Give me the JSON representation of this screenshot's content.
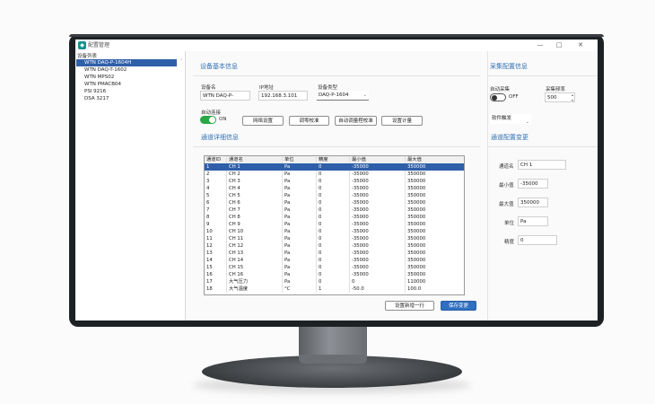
{
  "window": {
    "title": "配置管理",
    "icon": "app-icon",
    "min": "—",
    "max": "□",
    "close": "✕"
  },
  "device_list": {
    "header": "设备列表",
    "items": [
      {
        "label": "WTN DAQ-P-1604H",
        "selected": true
      },
      {
        "label": "WTN DAQ-T-1602",
        "selected": false
      },
      {
        "label": "WTN MPS02",
        "selected": false
      },
      {
        "label": "WTN PMACB04",
        "selected": false
      },
      {
        "label": "PSI 9216",
        "selected": false
      },
      {
        "label": "DSA 3217",
        "selected": false
      }
    ]
  },
  "basic": {
    "title": "设备基本信息",
    "name_label": "设备名",
    "name_value": "WTN DAQ-P-",
    "ip_label": "IP地址",
    "ip_value": "192.168.3.101",
    "type_label": "设备类型",
    "type_value": "DAQ-P-1604",
    "auto_label": "自动连接",
    "auto_state": "ON",
    "buttons": [
      "网络设置",
      "调零校准",
      "自动调量程校准",
      "设置计量"
    ]
  },
  "channels": {
    "title": "通道详细信息",
    "columns": [
      "通道ID",
      "通道名",
      "单位",
      "精度",
      "最小值",
      "最大值"
    ],
    "rows": [
      [
        "1",
        "CH 1",
        "Pa",
        "0",
        "-35000",
        "350000"
      ],
      [
        "2",
        "CH 2",
        "Pa",
        "0",
        "-35000",
        "350000"
      ],
      [
        "3",
        "CH 3",
        "Pa",
        "0",
        "-35000",
        "350000"
      ],
      [
        "4",
        "CH 4",
        "Pa",
        "0",
        "-35000",
        "350000"
      ],
      [
        "5",
        "CH 5",
        "Pa",
        "0",
        "-35000",
        "350000"
      ],
      [
        "6",
        "CH 6",
        "Pa",
        "0",
        "-35000",
        "350000"
      ],
      [
        "7",
        "CH 7",
        "Pa",
        "0",
        "-35000",
        "350000"
      ],
      [
        "8",
        "CH 8",
        "Pa",
        "0",
        "-35000",
        "350000"
      ],
      [
        "9",
        "CH 9",
        "Pa",
        "0",
        "-35000",
        "350000"
      ],
      [
        "10",
        "CH 10",
        "Pa",
        "0",
        "-35000",
        "350000"
      ],
      [
        "11",
        "CH 11",
        "Pa",
        "0",
        "-35000",
        "350000"
      ],
      [
        "12",
        "CH 12",
        "Pa",
        "0",
        "-35000",
        "350000"
      ],
      [
        "13",
        "CH 13",
        "Pa",
        "0",
        "-35000",
        "350000"
      ],
      [
        "14",
        "CH 14",
        "Pa",
        "0",
        "-35000",
        "350000"
      ],
      [
        "15",
        "CH 15",
        "Pa",
        "0",
        "-35000",
        "350000"
      ],
      [
        "16",
        "CH 16",
        "Pa",
        "0",
        "-35000",
        "350000"
      ],
      [
        "17",
        "大气压力",
        "Pa",
        "0",
        "0",
        "110000"
      ],
      [
        "18",
        "大气温度",
        "°C",
        "1",
        "-50.0",
        "100.0"
      ]
    ],
    "reset_button": "设置新增一行",
    "save_button": "保存变更"
  },
  "acq": {
    "title": "采集配置信息",
    "auto_label": "自动采集",
    "auto_state": "OFF",
    "rate_label": "采集频率",
    "rate_value": "500",
    "mode_value": "软件触发"
  },
  "chan_cfg": {
    "title": "通道配置变更",
    "name_label": "通道名",
    "name_value": "CH 1",
    "min_label": "最小值",
    "min_value": "-35000",
    "max_label": "最大值",
    "max_value": "350000",
    "unit_label": "单位",
    "unit_value": "Pa",
    "prec_label": "精度",
    "prec_value": "0"
  }
}
